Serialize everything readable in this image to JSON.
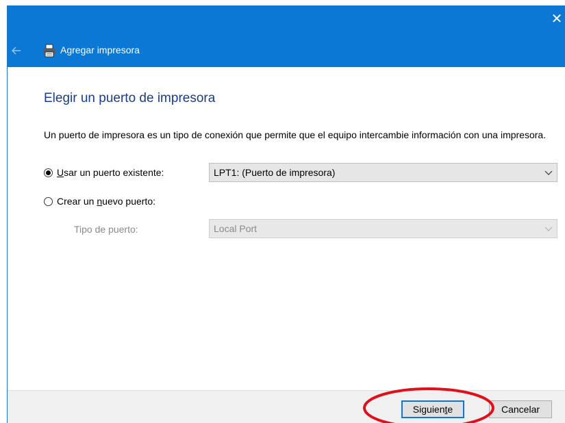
{
  "window": {
    "title": "Agregar impresora",
    "close_glyph": "✕",
    "back_icon": "arrow-left-icon",
    "title_icon": "printer-icon",
    "accent_color": "#0a78d4"
  },
  "content": {
    "heading": "Elegir un puerto de impresora",
    "description": "Un puerto de impresora es un tipo de conexión que permite que el equipo intercambie información con una impresora."
  },
  "options": {
    "existing": {
      "label_pre": "",
      "label_u": "U",
      "label_post": "sar un puerto existente:",
      "checked": true,
      "selected_value": "LPT1: (Puerto de impresora)"
    },
    "new_port": {
      "label_pre": "Crear un ",
      "label_u": "n",
      "label_post": "uevo puerto:",
      "checked": false,
      "type_label": "Tipo de puerto:",
      "type_value": "Local Port"
    }
  },
  "footer": {
    "next_pre": "Siguien",
    "next_u": "t",
    "next_post": "e",
    "cancel_label": "Cancelar"
  },
  "annotation": {
    "highlight_color": "#e0101a"
  }
}
